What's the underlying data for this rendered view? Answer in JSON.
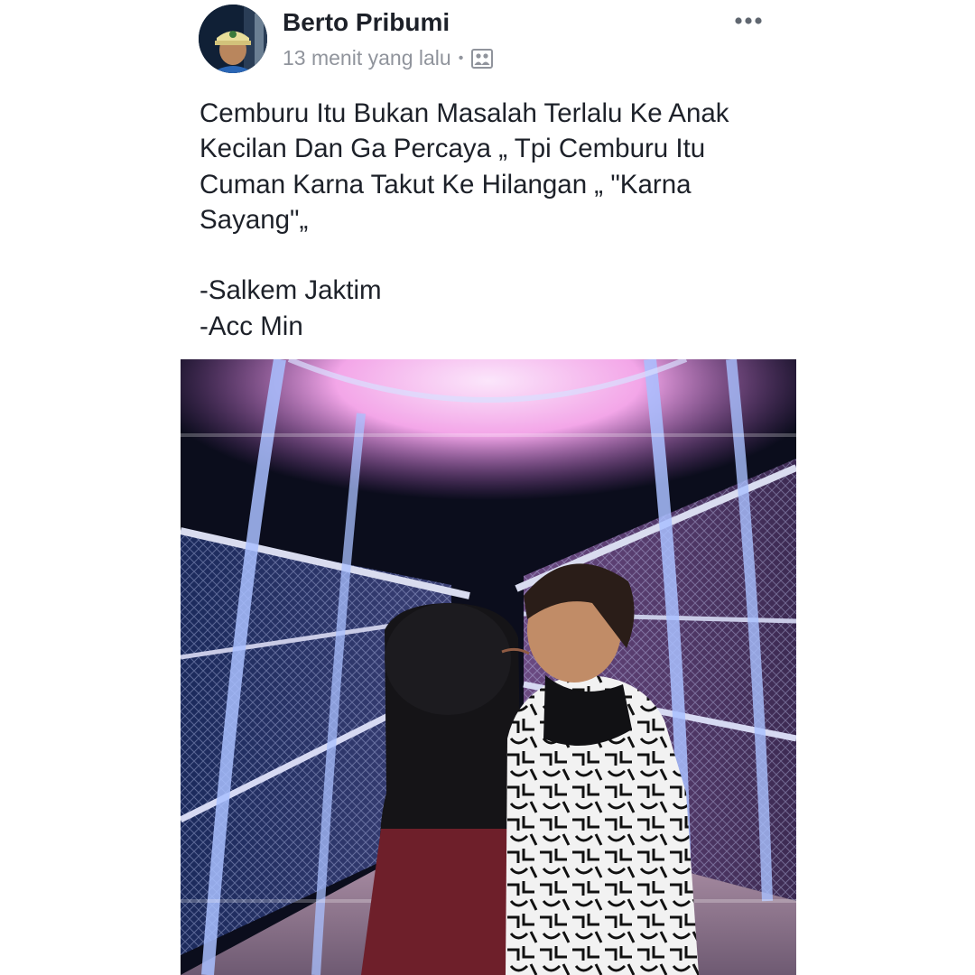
{
  "post": {
    "author_name": "Berto Pribumi",
    "timestamp": "13 menit yang lalu",
    "separator": "•",
    "audience_icon": "friends-icon",
    "more_icon": "more-horizontal-icon",
    "text_lines": [
      "Cemburu Itu Bukan Masalah Terlalu Ke Anak",
      "Kecilan Dan Ga Percaya „ Tpi Cemburu Itu",
      "Cuman Karna Takut Ke Hilangan „ \"Karna",
      "Sayang\"„",
      "",
      "-Salkem Jaktim",
      "-Acc Min"
    ]
  },
  "colors": {
    "author": "#1d2129",
    "meta": "#90949c",
    "bridge_pink": "#f3a6e8",
    "bridge_blue": "#9fb8ff"
  }
}
